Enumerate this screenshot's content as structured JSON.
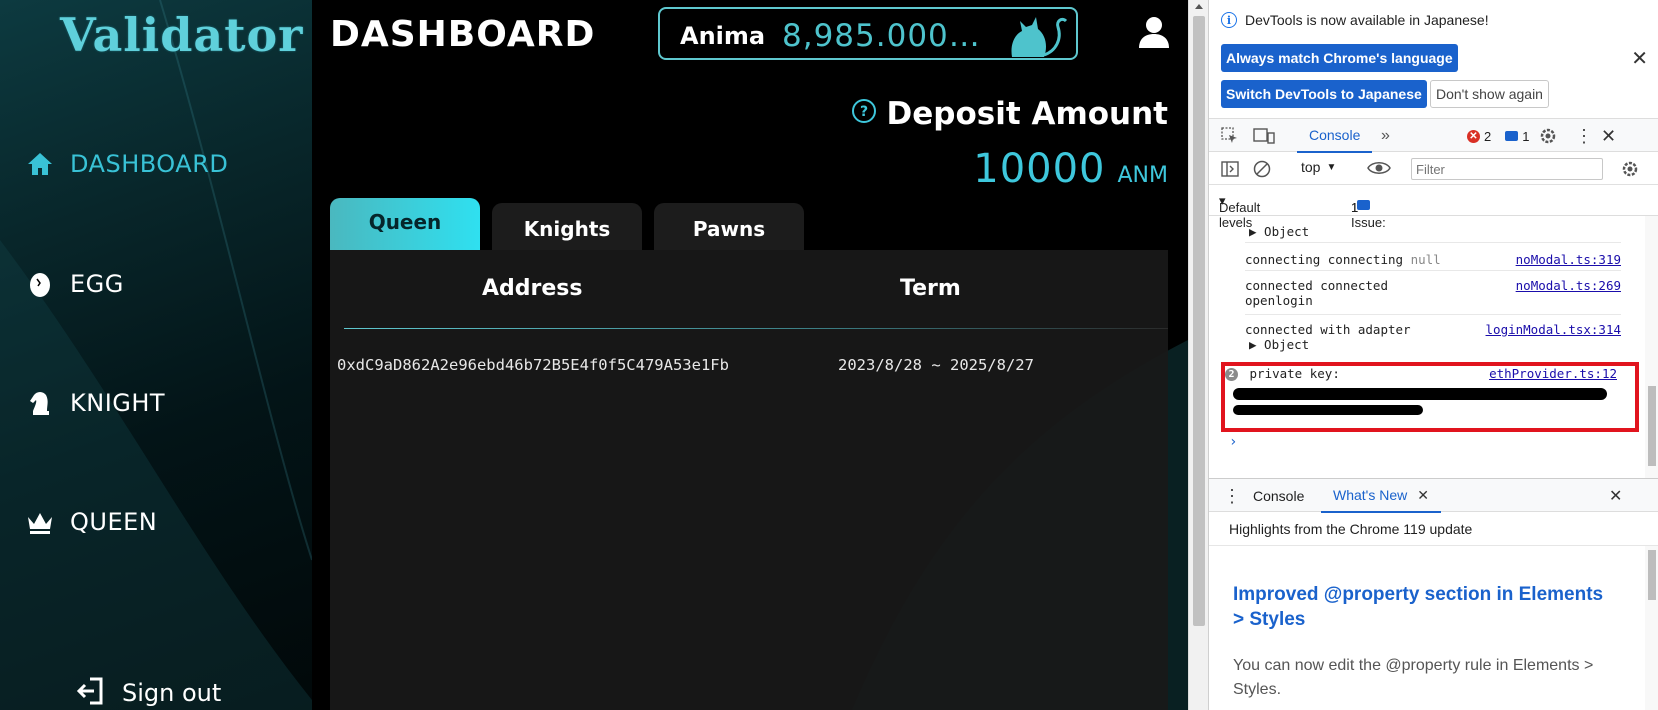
{
  "app": {
    "logo_text": "Validator",
    "page_title": "DASHBOARD",
    "balance": {
      "token": "Anima",
      "value": "8,985.000…"
    },
    "nav": [
      {
        "label": "DASHBOARD",
        "icon": "home-icon",
        "active": true
      },
      {
        "label": "EGG",
        "icon": "egg-icon",
        "active": false
      },
      {
        "label": "KNIGHT",
        "icon": "knight-icon",
        "active": false
      },
      {
        "label": "QUEEN",
        "icon": "crown-icon",
        "active": false
      }
    ],
    "sign_out": "Sign out",
    "deposit": {
      "label": "Deposit Amount",
      "amount": "10000",
      "unit": "ANM"
    },
    "tabs": [
      "Queen",
      "Knights",
      "Pawns"
    ],
    "active_tab": "Queen",
    "table": {
      "headers": [
        "Address",
        "Term"
      ],
      "rows": [
        {
          "address": "0xdC9aD862A2e96ebd46b72B5E4f0f5C479A53e1Fb",
          "term": "2023/8/28 ~ 2025/8/27"
        }
      ]
    },
    "colors": {
      "accent": "#3ec7dc",
      "background": "#000000",
      "sidebar": "#0b3035"
    }
  },
  "devtools": {
    "notice": "DevTools is now available in Japanese!",
    "btn_match": "Always match Chrome's language",
    "btn_switch": "Switch DevTools to Japanese",
    "btn_dont_show": "Don't show again",
    "tab_console": "Console",
    "error_count": "2",
    "message_count": "1",
    "context": "top",
    "filter_placeholder": "Filter",
    "levels": "Default levels",
    "issues_label": "1 Issue:",
    "issues_count": "1",
    "logs": [
      {
        "text": "▶ Object",
        "source": ""
      },
      {
        "text": "connecting connecting",
        "extra": "null",
        "source": "noModal.ts:319"
      },
      {
        "text": "connected connected",
        "text2": "openlogin",
        "source": "noModal.ts:269"
      },
      {
        "text": "connected with adapter",
        "text2": "▶ Object",
        "source": "loginModal.tsx:314"
      },
      {
        "text": "private key:",
        "badge": "2",
        "source": "ethProvider.ts:12"
      }
    ],
    "drawer_tab_console": "Console",
    "drawer_tab_whatsnew": "What's New",
    "whatsnew_head": "Highlights from the Chrome 119 update",
    "whatsnew_title": "Improved @property section in Elements > Styles",
    "whatsnew_desc": "You can now edit the @property rule in Elements > Styles.",
    "highlight_color": "#e1141e"
  }
}
